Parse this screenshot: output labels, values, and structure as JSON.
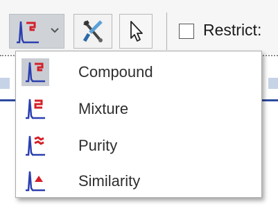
{
  "toolbar": {
    "mode_button_icon": "compound-peak-icon",
    "tools_button_icon": "tools-icon",
    "cursor_button_icon": "pointer-cursor-icon",
    "restrict_label": "Restrict:",
    "restrict_checked": false
  },
  "menu": {
    "items": [
      {
        "label": "Compound",
        "icon": "compound-peak-icon",
        "selected": true
      },
      {
        "label": "Mixture",
        "icon": "mixture-peak-icon",
        "selected": false
      },
      {
        "label": "Purity",
        "icon": "purity-peak-icon",
        "selected": false
      },
      {
        "label": "Similarity",
        "icon": "similarity-peak-icon",
        "selected": false
      }
    ]
  },
  "colors": {
    "peak_blue": "#2b3fb0",
    "accent_red": "#d4202a",
    "selection_gray": "#c9cdd3"
  }
}
